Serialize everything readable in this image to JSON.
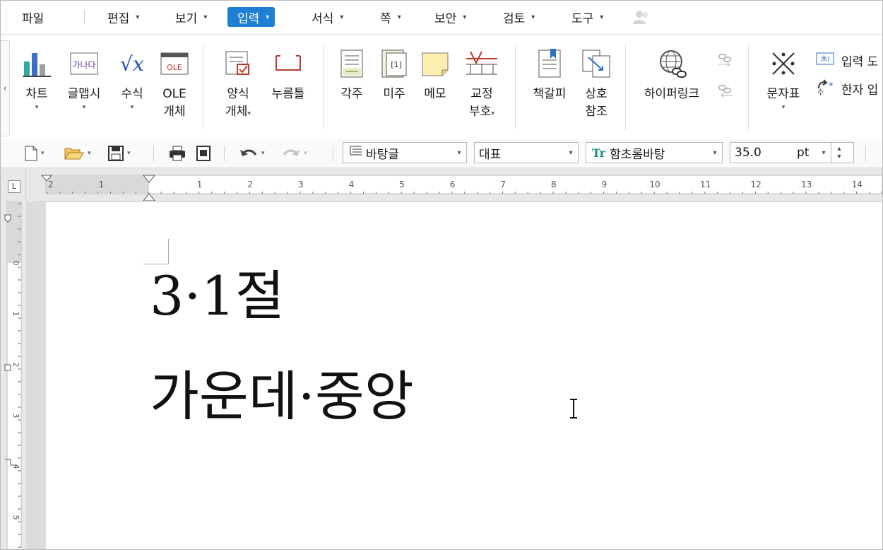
{
  "menu": {
    "items": [
      {
        "label": "파일",
        "caret": ""
      },
      {
        "label": "편집",
        "caret": "▾"
      },
      {
        "label": "보기",
        "caret": "▾"
      },
      {
        "label": "입력",
        "caret": "▾",
        "active": true
      },
      {
        "label": "서식",
        "caret": "▾"
      },
      {
        "label": "쪽",
        "caret": "▾"
      },
      {
        "label": "보안",
        "caret": "▾"
      },
      {
        "label": "검토",
        "caret": "▾"
      },
      {
        "label": "도구",
        "caret": "▾"
      }
    ]
  },
  "ribbon": {
    "scroll_left": "‹",
    "chart": {
      "label": "차트",
      "dd": "▾"
    },
    "glyph": {
      "label": "글맵시",
      "dd": "▾",
      "icon_text": "가나다"
    },
    "formula": {
      "label": "수식",
      "dd": "▾",
      "icon_text": "√x"
    },
    "ole": {
      "label1": "OLE",
      "label2": "개체",
      "icon_text": "OLE"
    },
    "form": {
      "label1": "양식",
      "label2": "개체",
      "dd": "▾"
    },
    "push": {
      "label": "누름틀"
    },
    "footnote": {
      "label": "각주"
    },
    "endnote": {
      "label": "미주",
      "icon_text": "[1]"
    },
    "memo": {
      "label": "메모"
    },
    "proof": {
      "label1": "교정",
      "label2": "부호",
      "dd": "▾"
    },
    "bookmark": {
      "label": "책갈피"
    },
    "crossref": {
      "label1": "상호",
      "label2": "참조"
    },
    "hyperlink": {
      "label": "하이퍼링크"
    },
    "chartable": {
      "label": "문자표",
      "dd": "▾"
    },
    "input_tool": {
      "label": "입력 도",
      "icon_text": "木I"
    },
    "hanja": {
      "label": "한자 입"
    }
  },
  "toolbar": {
    "caret": "▾",
    "style": "바탕글",
    "lang": "대표",
    "font": "함초롬바탕",
    "font_icon": "Tr",
    "size": "35.0",
    "unit": "pt",
    "spin_up": "▴",
    "spin_down": "▾"
  },
  "ruler": {
    "corner": "L",
    "h_labels": [
      "2",
      "1",
      "1",
      "2",
      "3",
      "4",
      "5",
      "6",
      "7",
      "8",
      "9",
      "10",
      "11",
      "12",
      "13",
      "14"
    ],
    "v_labels": [
      "0",
      "1",
      "2",
      "3",
      "4",
      "5"
    ]
  },
  "document": {
    "line1": "3·1절",
    "line2": "가운데·중앙"
  },
  "colors": {
    "accent": "#1e7fd3"
  }
}
